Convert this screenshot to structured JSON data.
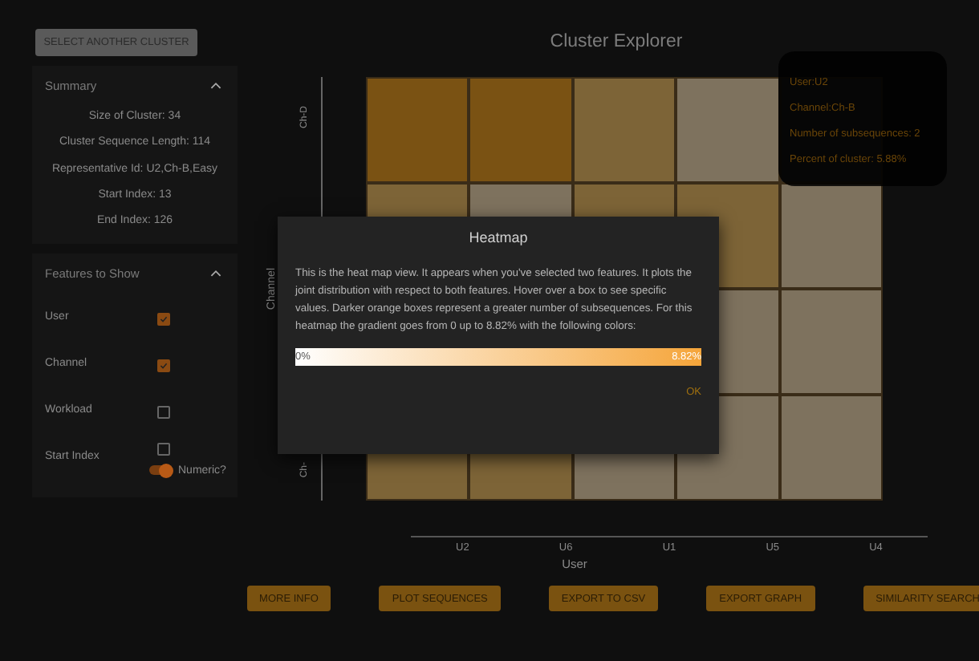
{
  "select_button": "SELECT ANOTHER CLUSTER",
  "summary": {
    "title": "Summary",
    "expanded": true,
    "lines": [
      "Size of Cluster: 34",
      "Cluster Sequence Length: 114",
      "Representative Id: U2,Ch-B,Easy",
      "Start Index: 13",
      "End Index: 126"
    ]
  },
  "features": {
    "title": "Features to Show",
    "expanded": true,
    "items": [
      {
        "label": "User",
        "checked": true
      },
      {
        "label": "Channel",
        "checked": true
      },
      {
        "label": "Workload",
        "checked": false
      },
      {
        "label": "Start Index",
        "checked": false,
        "toggle": {
          "label": "Numeric?",
          "on": true
        }
      }
    ]
  },
  "title": "Cluster Explorer",
  "heatmap": {
    "ylabel": "Channel",
    "xlabel": "User",
    "columns": [
      "U2",
      "U6",
      "U1",
      "U5",
      "U4"
    ],
    "rows": [
      {
        "label": "Ch-D",
        "cells": [
          {
            "color": "#7a5213"
          },
          {
            "color": "#7a5213"
          },
          {
            "color": "#7d6437"
          },
          {
            "color": "#7e725e"
          },
          {}
        ]
      },
      {
        "cells": [
          {
            "color": "#7d6437"
          },
          {
            "color": "#7e725e"
          },
          {
            "color": "#7d6437"
          },
          {
            "color": "#7d6437"
          },
          {
            "color": "#7e725e"
          }
        ]
      },
      {
        "cells": [
          {},
          {},
          {},
          {
            "color": "#7e725e"
          },
          {
            "color": "#7e725e"
          }
        ]
      },
      {
        "label": "Ch-",
        "cells": [
          {
            "color": "#7d6437"
          },
          {
            "color": "#7d6437"
          },
          {
            "color": "#7e725e"
          },
          {
            "color": "#7e725e"
          },
          {
            "color": "#7e725e"
          }
        ]
      }
    ]
  },
  "tooltip": [
    "User:U2",
    "Channel:Ch-B",
    "Number of subsequences: 2",
    "Percent of cluster: 5.88%"
  ],
  "actions": [
    "MORE INFO",
    "PLOT SEQUENCES",
    "EXPORT TO CSV",
    "EXPORT GRAPH",
    "SIMILARITY SEARCH"
  ],
  "dialog": {
    "title": "Heatmap",
    "text": "This is the heat map view. It appears when you've selected two features. It plots the joint distribution with respect to both features. Hover over a box to see specific values. Darker orange boxes represent a greater number of subsequences. For this heatmap the gradient goes from 0 up to 8.82% with the following colors:",
    "gradient_min": "0%",
    "gradient_max": "8.82%",
    "ok": "OK"
  }
}
